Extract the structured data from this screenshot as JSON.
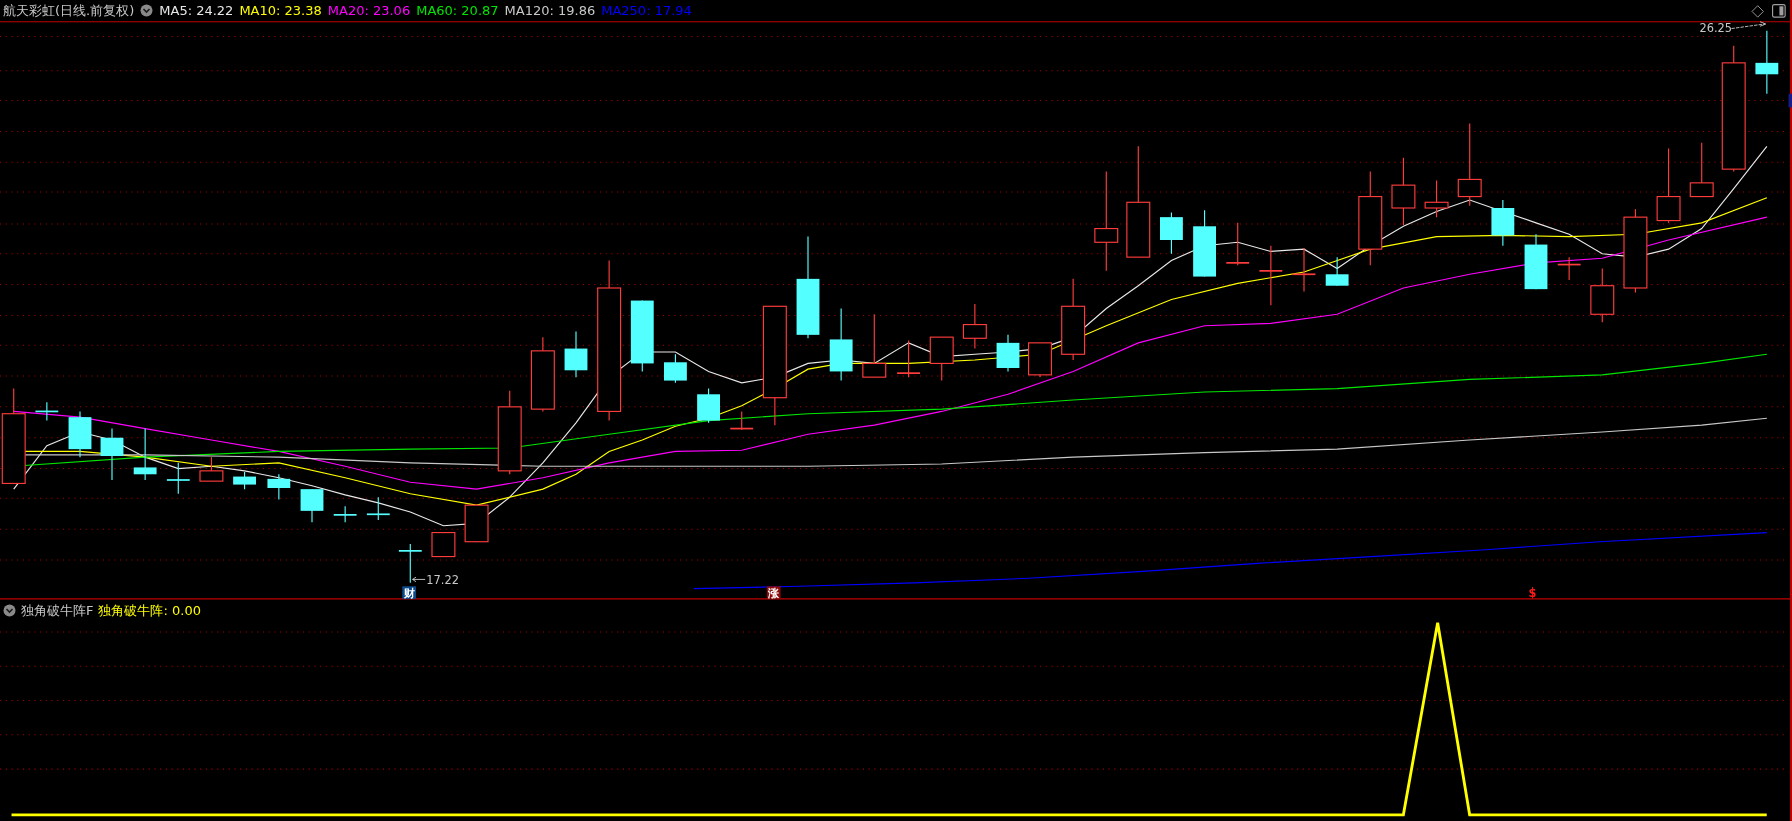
{
  "main_panel": {
    "title": "航天彩虹(日线.前复权)",
    "ma_legend": [
      {
        "label": "MA5: 24.22",
        "color": "#e8e8e8"
      },
      {
        "label": "MA10: 23.38",
        "color": "#ffff00"
      },
      {
        "label": "MA20: 23.06",
        "color": "#ff00ff"
      },
      {
        "label": "MA60: 20.87",
        "color": "#00e600"
      },
      {
        "label": "MA120: 19.86",
        "color": "#c8c8c8"
      },
      {
        "label": "MA250: 17.94",
        "color": "#0000ff"
      }
    ],
    "high_label": "26.25",
    "low_label": "17.22",
    "markers": [
      {
        "text": "财",
        "color": "#0d4a8c"
      },
      {
        "text": "涨",
        "color": "#8c0a0a"
      },
      {
        "text": "$",
        "color": "#ff1a1a"
      }
    ]
  },
  "indicator_panel": {
    "name": "独角破牛阵F",
    "reading": "独角破牛阵: 0.00"
  }
}
